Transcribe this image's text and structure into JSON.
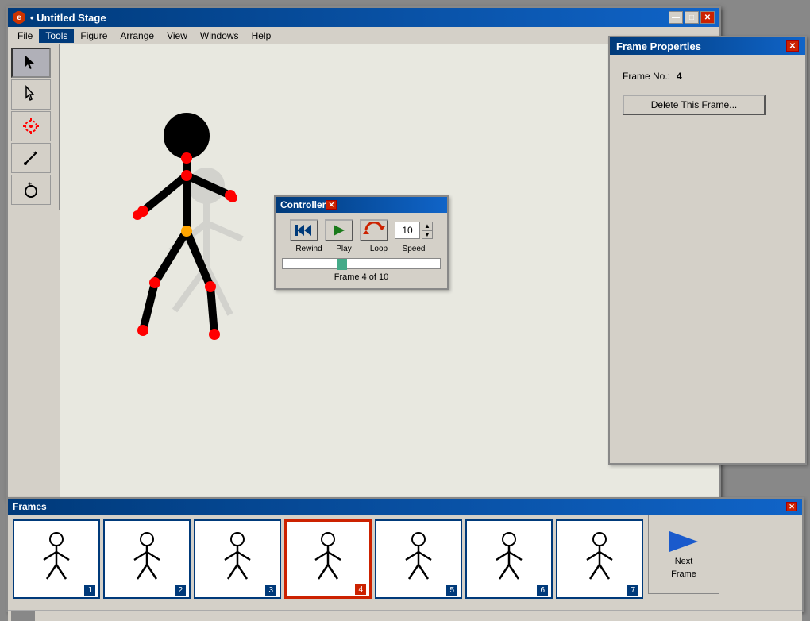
{
  "app": {
    "title": "• Untitled Stage",
    "icon": "e"
  },
  "titlebar": {
    "minimize": "—",
    "maximize": "□",
    "close": "✕"
  },
  "menu": {
    "items": [
      "File",
      "Tools",
      "Figure",
      "Arrange",
      "View",
      "Windows",
      "Help"
    ]
  },
  "tools": [
    {
      "name": "select-arrow",
      "symbol": "▲"
    },
    {
      "name": "pointer",
      "symbol": "↖"
    },
    {
      "name": "transform",
      "symbol": "✳"
    },
    {
      "name": "pencil",
      "symbol": "✏"
    },
    {
      "name": "circle",
      "symbol": "○"
    }
  ],
  "controller": {
    "title": "Controller",
    "rewind_label": "Rewind",
    "play_label": "Play",
    "loop_label": "Loop",
    "speed_label": "Speed",
    "speed_value": "10",
    "frame_info": "Frame 4 of 10",
    "progress_pct": 35
  },
  "frame_properties": {
    "title": "Frame Properties",
    "frame_no_label": "Frame No.:",
    "frame_no_value": "4",
    "delete_btn_label": "Delete This Frame..."
  },
  "frames": {
    "title": "Frames",
    "items": [
      {
        "num": "1",
        "active": false
      },
      {
        "num": "2",
        "active": false
      },
      {
        "num": "3",
        "active": false
      },
      {
        "num": "4",
        "active": true
      },
      {
        "num": "5",
        "active": false
      },
      {
        "num": "6",
        "active": false
      },
      {
        "num": "7",
        "active": false
      }
    ],
    "next_frame_line1": "Next",
    "next_frame_line2": "Frame"
  }
}
